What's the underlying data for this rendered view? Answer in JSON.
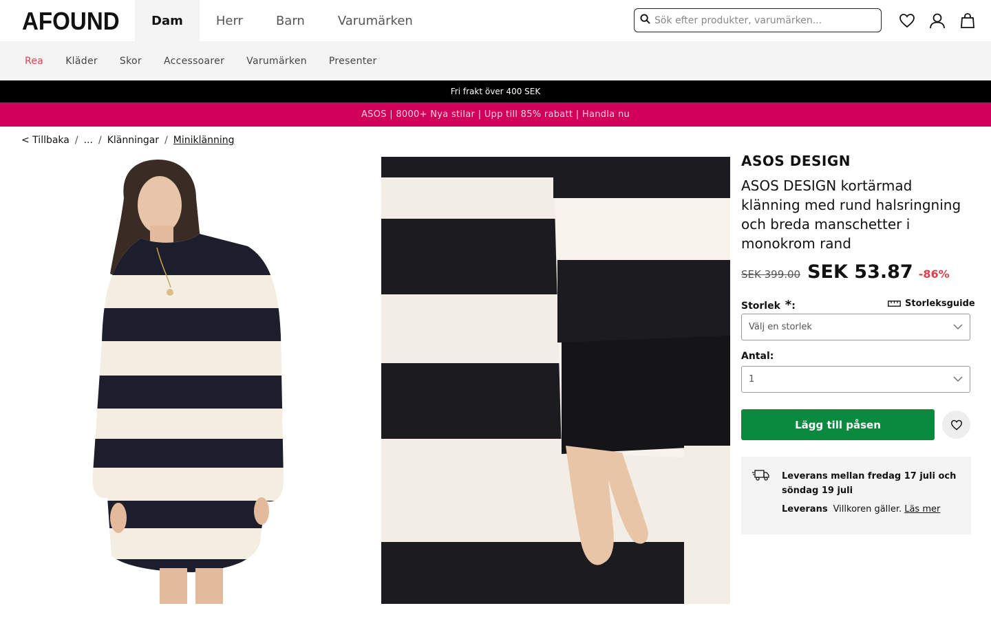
{
  "header": {
    "logo": "AFOUND",
    "nav": [
      {
        "label": "Dam",
        "active": true
      },
      {
        "label": "Herr",
        "active": false
      },
      {
        "label": "Barn",
        "active": false
      },
      {
        "label": "Varumärken",
        "active": false
      }
    ],
    "search_placeholder": "Sök efter produkter, varumärken..."
  },
  "categories": [
    "Rea",
    "Kläder",
    "Skor",
    "Accessoarer",
    "Varumärken",
    "Presenter"
  ],
  "promo": {
    "shipping": "Fri frakt över 400 SEK",
    "banner": "ASOS | 8000+ Nya stilar | Upp till 85% rabatt | Handla nu"
  },
  "breadcrumb": {
    "back": "< Tillbaka",
    "ellipsis": "...",
    "category": "Klänningar",
    "current": "Miniklänning"
  },
  "product": {
    "brand": "ASOS DESIGN",
    "title": "ASOS DESIGN kortärmad klänning med rund halsringning och breda manschetter i monokrom rand",
    "old_price": "SEK 399.00",
    "price": "SEK 53.87",
    "discount": "-86%",
    "size_label": "Storlek",
    "size_required": "*",
    "size_guide": "Storleksguide",
    "size_placeholder": "Välj en storlek",
    "qty_label": "Antal:",
    "qty_value": "1",
    "add_to_bag": "Lägg till påsen"
  },
  "delivery": {
    "title": "Leverans mellan fredag 17 juli och söndag 19 juli",
    "label": "Leverans",
    "text": "Villkoren gäller.",
    "link": "Läs mer"
  },
  "colors": {
    "sale_red": "#d9434e",
    "promo_pink": "#d1005a",
    "cta_green": "#0a8a3f"
  }
}
